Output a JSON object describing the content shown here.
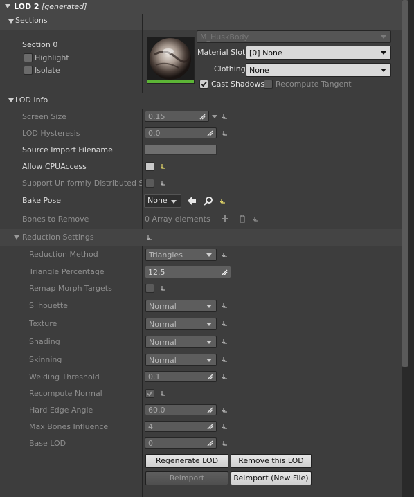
{
  "header": {
    "title": "LOD 2",
    "tag": "[generated]"
  },
  "sections": {
    "label": "Sections",
    "section0_label": "Section 0",
    "highlight_label": "Highlight",
    "isolate_label": "Isolate",
    "material_name": "M_HuskBody",
    "material_slot_label": "Material Slot",
    "material_slot_value": "[0] None",
    "clothing_label": "Clothing",
    "clothing_value": "None",
    "cast_shadows_label": "Cast Shadows",
    "recompute_tangent_label": "Recompute Tangent"
  },
  "lod_info": {
    "label": "LOD Info",
    "screen_size_label": "Screen Size",
    "screen_size_value": "0.15",
    "lod_hysteresis_label": "LOD Hysteresis",
    "lod_hysteresis_value": "0.0",
    "source_import_label": "Source Import Filename",
    "allow_cpu_label": "Allow CPUAccess",
    "support_uniform_label": "Support Uniformly Distributed Sam",
    "bake_pose_label": "Bake Pose",
    "bake_pose_value": "None",
    "bones_label": "Bones to Remove",
    "bones_value": "0 Array elements"
  },
  "reduction": {
    "label": "Reduction Settings",
    "method_label": "Reduction Method",
    "method_value": "Triangles",
    "tri_pct_label": "Triangle Percentage",
    "tri_pct_value": "12.5",
    "remap_label": "Remap Morph Targets",
    "silhouette_label": "Silhouette",
    "silhouette_value": "Normal",
    "texture_label": "Texture",
    "texture_value": "Normal",
    "shading_label": "Shading",
    "shading_value": "Normal",
    "skinning_label": "Skinning",
    "skinning_value": "Normal",
    "welding_label": "Welding Threshold",
    "welding_value": "0.1",
    "recompute_label": "Recompute Normal",
    "hard_edge_label": "Hard Edge Angle",
    "hard_edge_value": "60.0",
    "max_bones_label": "Max Bones Influence",
    "max_bones_value": "4",
    "base_lod_label": "Base LOD",
    "base_lod_value": "0"
  },
  "buttons": {
    "regenerate": "Regenerate LOD",
    "remove": "Remove this LOD",
    "reimport": "Reimport",
    "reimport_new": "Reimport (New File)"
  }
}
